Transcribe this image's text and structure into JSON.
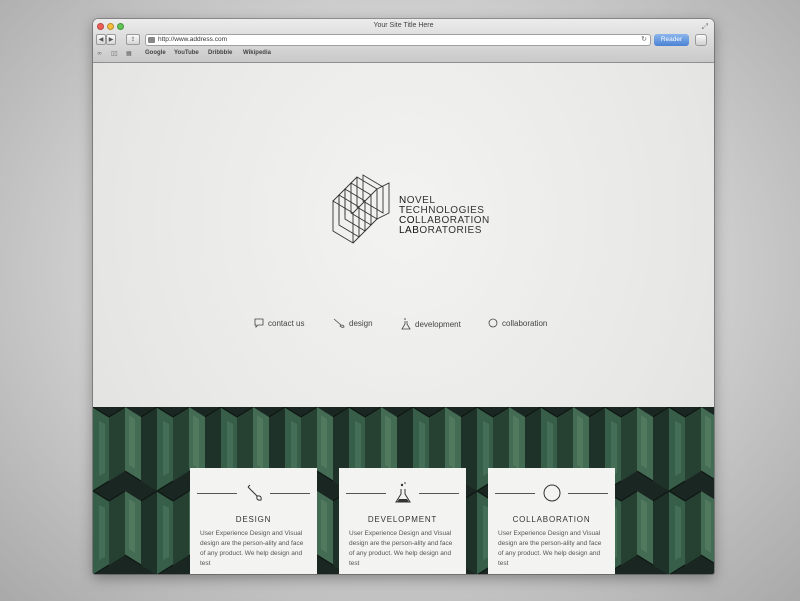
{
  "browser": {
    "title": "Your Site Title Here",
    "url": "http://www.address.com",
    "reader_label": "Reader",
    "bookmarks": [
      "Google",
      "YouTube",
      "Dribbble",
      "Wikipedia"
    ]
  },
  "logo": {
    "lines": [
      {
        "strong": "N",
        "rest": "OVEL"
      },
      {
        "strong": "T",
        "rest": "ECHNOLOGIES"
      },
      {
        "strong": "CO",
        "rest": "LLABORATION"
      },
      {
        "strong": "LAB",
        "rest": "ORATORIES"
      }
    ]
  },
  "nav": [
    {
      "label": "contact us",
      "icon": "speech-bubble-icon"
    },
    {
      "label": "design",
      "icon": "brush-icon"
    },
    {
      "label": "development",
      "icon": "flask-icon"
    },
    {
      "label": "collaboration",
      "icon": "compass-icon"
    }
  ],
  "cards": [
    {
      "title": "DESIGN",
      "icon": "brush-icon",
      "text": "User Experience Design and Visual design are the person-ality and face of any product. We help design and test"
    },
    {
      "title": "DEVELOPMENT",
      "icon": "flask-icon",
      "text": "User Experience Design and Visual design are the person-ality and face of any product. We help design and test"
    },
    {
      "title": "COLLABORATION",
      "icon": "compass-icon",
      "text": "User Experience Design and Visual design are the person-ality and face of any product. We help design and test"
    }
  ],
  "colors": {
    "pattern_dark": "#1e2c26",
    "pattern_green": "#3f6b52",
    "pattern_mid": "#2c4a3a",
    "reader_blue": "#4b82d4"
  }
}
